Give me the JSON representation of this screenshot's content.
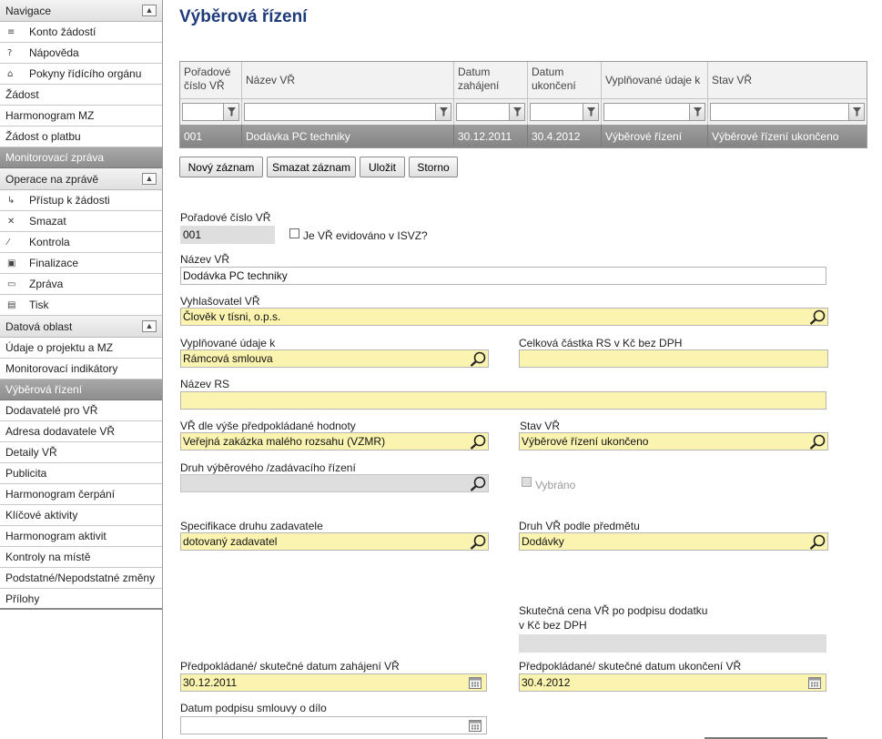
{
  "sidebar": {
    "nav_header": "Navigace",
    "nav_items": [
      {
        "label": "Konto žádostí",
        "icon": "accounts-icon"
      },
      {
        "label": "Nápověda",
        "icon": "help-icon"
      },
      {
        "label": "Pokyny řídícího orgánu",
        "icon": "instructions-icon"
      }
    ],
    "items_top": [
      "Žádost",
      "Harmonogram MZ",
      "Žádost o platbu"
    ],
    "monitoring_report": "Monitorovací zpráva",
    "ops_header": "Operace na zprávě",
    "ops_items": [
      {
        "label": "Přístup k žádosti",
        "icon": "access-icon"
      },
      {
        "label": "Smazat",
        "icon": "delete-icon"
      },
      {
        "label": "Kontrola",
        "icon": "check-icon"
      },
      {
        "label": "Finalizace",
        "icon": "finalize-icon"
      },
      {
        "label": "Zpráva",
        "icon": "report-icon"
      },
      {
        "label": "Tisk",
        "icon": "print-icon"
      }
    ],
    "data_header": "Datová oblast",
    "data_items": [
      "Údaje o projektu a MZ",
      "Monitorovací indikátory",
      "Výběrová řízení",
      "Dodavatelé pro VŘ",
      "Adresa dodavatele VŘ",
      "Detaily VŘ",
      "Publicita",
      "Harmonogram čerpání",
      "Klíčové aktivity",
      "Harmonogram aktivit",
      "Kontroly na místě",
      "Podstatné/Nepodstatné změny",
      "Přílohy"
    ],
    "selected_item": "Výběrová řízení"
  },
  "page": {
    "title": "Výběrová řízení"
  },
  "grid": {
    "columns": [
      "Pořadové číslo VŘ",
      "Název VŘ",
      "Datum zahájení",
      "Datum ukončení",
      "Vyplňované údaje k",
      "Stav VŘ"
    ],
    "rows": [
      [
        "001",
        "Dodávka PC techniky",
        "30.12.2011",
        "30.4.2012",
        "Výběrové řízení",
        "Výběrové řízení ukončeno"
      ]
    ]
  },
  "buttons": {
    "new": "Nový záznam",
    "delete": "Smazat záznam",
    "save": "Uložit",
    "cancel": "Storno"
  },
  "form": {
    "order_label": "Pořadové číslo VŘ",
    "order_value": "001",
    "isvz_label": "Je VŘ evidováno v ISVZ?",
    "isvz_checked": false,
    "name_label": "Název VŘ",
    "name_value": "Dodávka PC techniky",
    "announcer_label": "Vyhlašovatel VŘ",
    "announcer_value": "Člověk v tísni, o.p.s.",
    "filled_for_label": "Vyplňované údaje k",
    "filled_for_value": "Rámcová smlouva",
    "total_amount_label": "Celková částka RS v Kč bez DPH",
    "total_amount_value": "",
    "rs_name_label": "Název RS",
    "rs_name_value": "",
    "tender_by_value_label": "VŘ dle výše předpokládané hodnoty",
    "tender_by_value_value": "Veřejná zakázka malého rozsahu (VZMR)",
    "status_label": "Stav VŘ",
    "status_value": "Výběrové řízení ukončeno",
    "procedure_type_label": "Druh výběrového /zadávacího řízení",
    "procedure_type_value": "",
    "selected_label": "Vybráno",
    "selected_checked": false,
    "contracting_spec_label": "Specifikace druhu zadavatele",
    "contracting_spec_value": "dotovaný zadavatel",
    "subject_type_label": "Druh VŘ podle předmětu",
    "subject_type_value": "Dodávky",
    "actual_price_label_1": "Skutečná cena VŘ po podpisu dodatku",
    "actual_price_label_2": "v Kč bez DPH",
    "actual_price_value": "",
    "start_date_label": "Předpokládané/ skutečné datum zahájení VŘ",
    "start_date_value": "30.12.2011",
    "end_date_label": "Předpokládané/ skutečné datum ukončení VŘ",
    "end_date_value": "30.4.2012",
    "sign_date_label": "Datum podpisu smlouvy o dílo",
    "sign_date_value": ""
  },
  "colors": {
    "title": "#1f3a7a",
    "required_field": "#fbf4b0",
    "selected_row": "#8e8e8e"
  }
}
